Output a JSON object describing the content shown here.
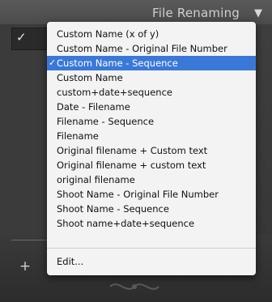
{
  "header": {
    "title": "File Renaming",
    "arrow_glyph": "▼"
  },
  "left_panel": {
    "check_glyph": "✓",
    "plus_glyph": "+"
  },
  "menu": {
    "items": [
      {
        "label": "Custom Name (x of y)"
      },
      {
        "label": "Custom Name - Original File Number"
      },
      {
        "label": "Custom Name - Sequence",
        "selected": true,
        "check": "✓"
      },
      {
        "label": "Custom Name"
      },
      {
        "label": "custom+date+sequence"
      },
      {
        "label": "Date - Filename"
      },
      {
        "label": "Filename - Sequence"
      },
      {
        "label": "Filename"
      },
      {
        "label": "Original filename + Custom text"
      },
      {
        "label": "Original filename + custom text"
      },
      {
        "label": "original filename"
      },
      {
        "label": "Shoot Name - Original File Number"
      },
      {
        "label": "Shoot Name - Sequence"
      },
      {
        "label": "Shoot name+date+sequence"
      }
    ],
    "edit_label": "Edit..."
  },
  "colors": {
    "selection": "#3a78d8",
    "menu_bg": "#f3f3f3",
    "panel_bg": "#3f3f3f"
  }
}
